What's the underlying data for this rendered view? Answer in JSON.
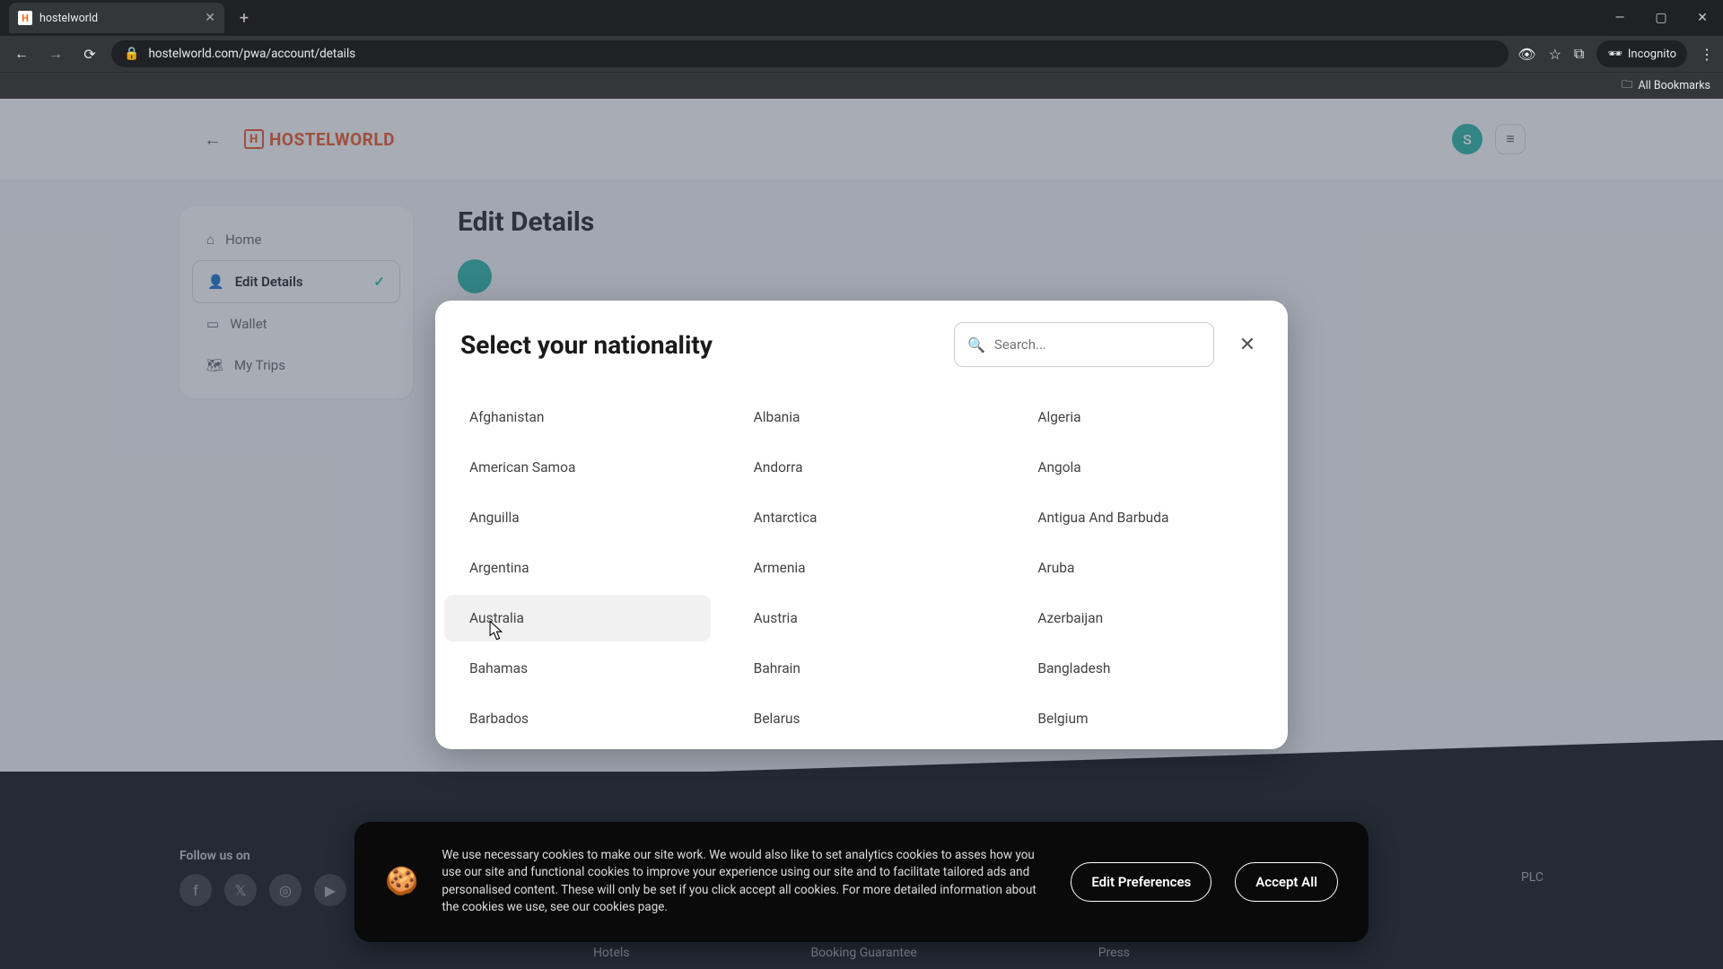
{
  "browser": {
    "tab_title": "hostelworld",
    "url": "hostelworld.com/pwa/account/details",
    "incognito_label": "Incognito",
    "all_bookmarks": "All Bookmarks"
  },
  "header": {
    "logo_text": "HOSTELWORLD",
    "logo_mark": "H",
    "avatar_initial": "S"
  },
  "sidebar": {
    "items": [
      {
        "label": "Home"
      },
      {
        "label": "Edit Details"
      },
      {
        "label": "Wallet"
      },
      {
        "label": "My Trips"
      }
    ]
  },
  "main": {
    "title": "Edit Details"
  },
  "modal": {
    "title": "Select your nationality",
    "search_placeholder": "Search...",
    "options": [
      "Afghanistan",
      "Albania",
      "Algeria",
      "American Samoa",
      "Andorra",
      "Angola",
      "Anguilla",
      "Antarctica",
      "Antigua And Barbuda",
      "Argentina",
      "Armenia",
      "Aruba",
      "Australia",
      "Austria",
      "Azerbaijan",
      "Bahamas",
      "Bahrain",
      "Bangladesh",
      "Barbados",
      "Belarus",
      "Belgium"
    ],
    "highlight_index": 12
  },
  "cookie": {
    "text": "We use necessary cookies to make our site work. We would also like to set analytics cookies to asses how you use our site and functional cookies to improve your experience using our site and to facilitate tailored ads and personalised content. These will only be set if you click accept all cookies. For more detailed information about the cookies we use, see our cookies page.",
    "edit": "Edit Preferences",
    "accept": "Accept All"
  },
  "footer": {
    "follow": "Follow us on",
    "plc": "PLC",
    "links": [
      "Hotels",
      "Booking Guarantee",
      "Press"
    ]
  }
}
